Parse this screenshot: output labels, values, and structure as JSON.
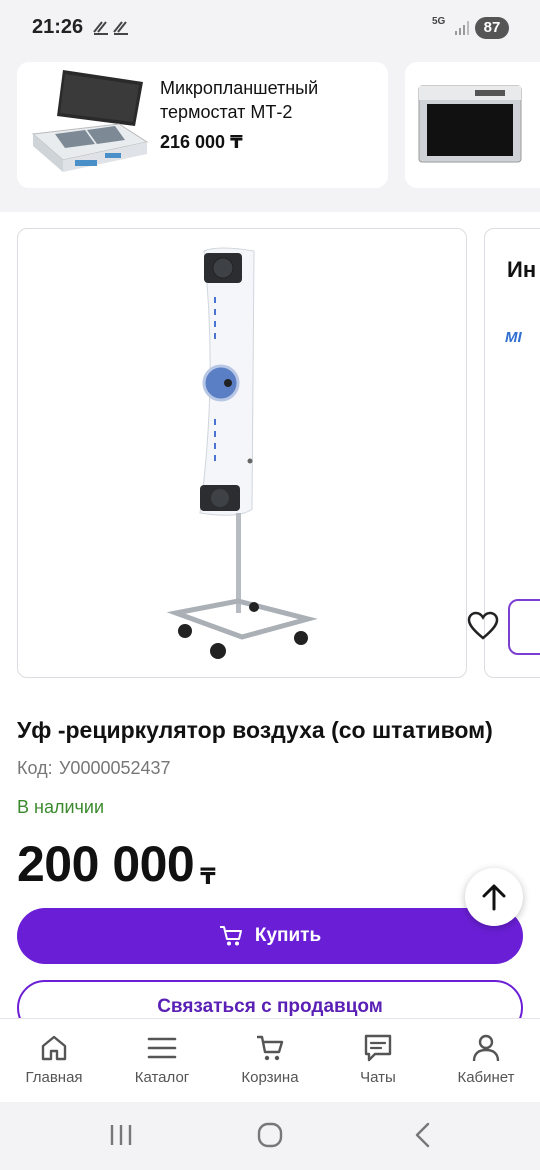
{
  "status_bar": {
    "time": "21:26",
    "network": "5G",
    "battery": "87"
  },
  "related_products": [
    {
      "name": "Микропланшетный термостат МТ-2",
      "price": "216 000 ₸"
    },
    {
      "name": "",
      "price": ""
    }
  ],
  "next_card": {
    "title": "Ин",
    "logo": "MI"
  },
  "product": {
    "title": "Уф -рециркулятор воздуха (со штативом)",
    "code_label": "Код:",
    "code": "У0000052437",
    "stock": "В наличии",
    "price": "200 000",
    "currency": "₸"
  },
  "actions": {
    "buy_label": "Купить",
    "contact_label": "Связаться с продавцом"
  },
  "bottom_nav": {
    "items": [
      {
        "label": "Главная",
        "icon": "home-icon"
      },
      {
        "label": "Каталог",
        "icon": "menu-icon"
      },
      {
        "label": "Корзина",
        "icon": "cart-icon"
      },
      {
        "label": "Чаты",
        "icon": "chat-icon"
      },
      {
        "label": "Кабинет",
        "icon": "user-icon"
      }
    ]
  },
  "colors": {
    "accent": "#6a1fd6",
    "in_stock": "#3c8a2e",
    "background": "#f3f3f6"
  }
}
